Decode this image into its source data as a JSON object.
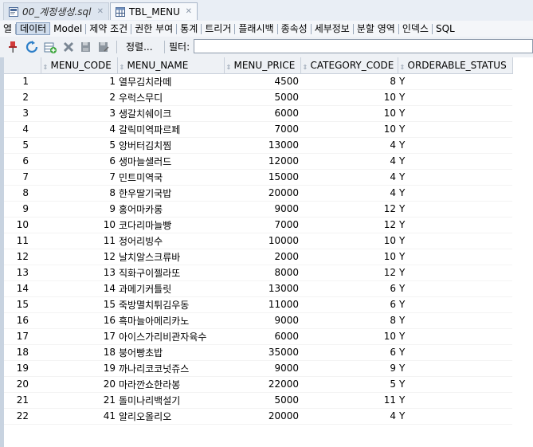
{
  "editor_tabs": [
    {
      "label": "00_계정생성.sql",
      "active": false,
      "icon": "sql-file-icon"
    },
    {
      "label": "TBL_MENU",
      "active": true,
      "icon": "table-icon"
    }
  ],
  "sub_tabs": [
    "열",
    "데이터",
    "Model",
    "제약 조건",
    "권한 부여",
    "통계",
    "트리거",
    "플래시백",
    "종속성",
    "세부정보",
    "분할 영역",
    "인덱스",
    "SQL"
  ],
  "selected_sub_tab": "데이터",
  "toolbar": {
    "sort_label": "정렬...",
    "filter_label": "필터:",
    "filter_value": ""
  },
  "table": {
    "columns": [
      "MENU_CODE",
      "MENU_NAME",
      "MENU_PRICE",
      "CATEGORY_CODE",
      "ORDERABLE_STATUS"
    ],
    "rows": [
      [
        "1",
        "1",
        "열무김치라떼",
        "4500",
        "8",
        "Y"
      ],
      [
        "2",
        "2",
        "우럭스무디",
        "5000",
        "10",
        "Y"
      ],
      [
        "3",
        "3",
        "생갈치쉐이크",
        "6000",
        "10",
        "Y"
      ],
      [
        "4",
        "4",
        "갈릭미역파르페",
        "7000",
        "10",
        "Y"
      ],
      [
        "5",
        "5",
        "앙버터김치찜",
        "13000",
        "4",
        "Y"
      ],
      [
        "6",
        "6",
        "생마늘샐러드",
        "12000",
        "4",
        "Y"
      ],
      [
        "7",
        "7",
        "민트미역국",
        "15000",
        "4",
        "Y"
      ],
      [
        "8",
        "8",
        "한우딸기국밥",
        "20000",
        "4",
        "Y"
      ],
      [
        "9",
        "9",
        "홍어마카롱",
        "9000",
        "12",
        "Y"
      ],
      [
        "10",
        "10",
        "코다리마늘빵",
        "7000",
        "12",
        "Y"
      ],
      [
        "11",
        "11",
        "정어리빙수",
        "10000",
        "10",
        "Y"
      ],
      [
        "12",
        "12",
        "날치알스크류바",
        "2000",
        "10",
        "Y"
      ],
      [
        "13",
        "13",
        "직화구이젤라또",
        "8000",
        "12",
        "Y"
      ],
      [
        "14",
        "14",
        "과메기커틀릿",
        "13000",
        "6",
        "Y"
      ],
      [
        "15",
        "15",
        "죽방멸치튀김우동",
        "11000",
        "6",
        "Y"
      ],
      [
        "16",
        "16",
        "흑마늘아메리카노",
        "9000",
        "8",
        "Y"
      ],
      [
        "17",
        "17",
        "아이스가리비관자육수",
        "6000",
        "10",
        "Y"
      ],
      [
        "18",
        "18",
        "붕어빵초밥",
        "35000",
        "6",
        "Y"
      ],
      [
        "19",
        "19",
        "까나리코코넛쥬스",
        "9000",
        "9",
        "Y"
      ],
      [
        "20",
        "20",
        "마라깐쇼한라봉",
        "22000",
        "5",
        "Y"
      ],
      [
        "21",
        "21",
        "돌미나리백설기",
        "5000",
        "11",
        "Y"
      ],
      [
        "22",
        "41",
        "알리오올리오",
        "20000",
        "4",
        "Y"
      ]
    ]
  }
}
